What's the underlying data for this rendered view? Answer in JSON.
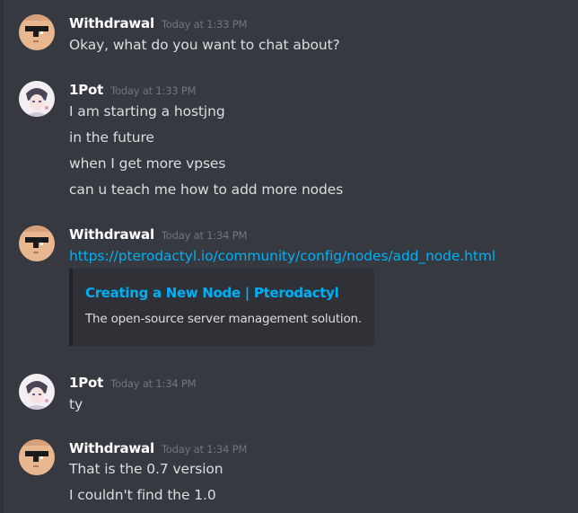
{
  "messages": [
    {
      "author": "Withdrawal",
      "timestamp": "Today at 1:33 PM",
      "avatar": "pixel-sunglasses-face-icon",
      "lines": [
        "Okay, what do you want to chat about?"
      ]
    },
    {
      "author": "1Pot",
      "timestamp": "Today at 1:33 PM",
      "avatar": "anime-character-avatar",
      "lines": [
        "I am starting a hostjng",
        "in the future",
        "when I get more vpses",
        "can u teach me how to add more nodes"
      ]
    },
    {
      "author": "Withdrawal",
      "timestamp": "Today at 1:34 PM",
      "avatar": "pixel-sunglasses-face-icon",
      "link": "https://pterodactyl.io/community/config/nodes/add_node.html",
      "embed": {
        "title": "Creating a New Node | Pterodactyl",
        "description": "The open-source server management solution."
      }
    },
    {
      "author": "1Pot",
      "timestamp": "Today at 1:34 PM",
      "avatar": "anime-character-avatar",
      "lines": [
        "ty"
      ]
    },
    {
      "author": "Withdrawal",
      "timestamp": "Today at 1:34 PM",
      "avatar": "pixel-sunglasses-face-icon",
      "lines": [
        "That is the 0.7 version",
        "I couldn't find the 1.0"
      ]
    }
  ],
  "colors": {
    "background": "#36393f",
    "embed_background": "#2f3136",
    "link": "#00b0f4",
    "timestamp": "#72767d",
    "message_text": "#dcddde"
  }
}
